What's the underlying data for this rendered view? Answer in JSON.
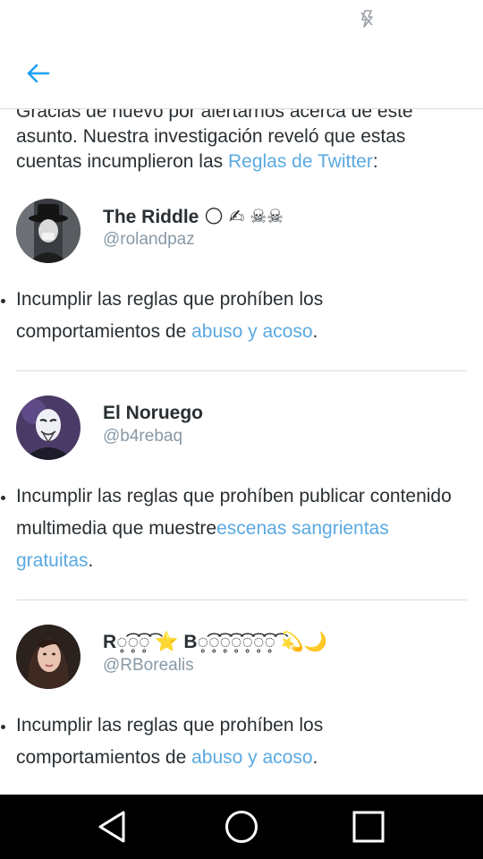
{
  "intro": {
    "text": "Gracias de nuevo por alertarnos acerca de este asunto. Nuestra investigación reveló que estas cuentas incumplieron las ",
    "link": "Reglas de Twitter",
    "end": ":"
  },
  "accounts": [
    {
      "name": "The Riddle 🌕 ✍ ☠☠",
      "handle": "@rolandpaz",
      "rule_text": "Incumplir las reglas que prohíben los comportamientos de ",
      "rule_link": "abuso y acoso",
      "rule_end": "."
    },
    {
      "name": "El Noruego",
      "handle": "@b4rebaq",
      "rule_text": "Incumplir las reglas que prohíben publicar contenido multimedia que muestre",
      "rule_link": "escenas sangrientas gratuitas",
      "rule_end": "."
    },
    {
      "name": "R◌̥͡◌̥͡◌̥͡ ⭐ B◌̥͡◌̥͡◌̥͡◌̥͡◌̥͡◌̥͡◌̥͡ 💫🌙",
      "handle": "@RBorealis",
      "rule_text": "Incumplir las reglas que prohíben los comportamientos de ",
      "rule_link": "abuso y acoso",
      "rule_end": "."
    }
  ],
  "colors": {
    "link": "#5aa9e1",
    "text": "#292f33",
    "secondary": "#8899a6",
    "nav_background": "#000000"
  },
  "icons": {
    "status": "flash-off-icon",
    "back": "arrow-left-icon",
    "nav": [
      "back-triangle-icon",
      "home-circle-icon",
      "recents-square-icon"
    ]
  }
}
